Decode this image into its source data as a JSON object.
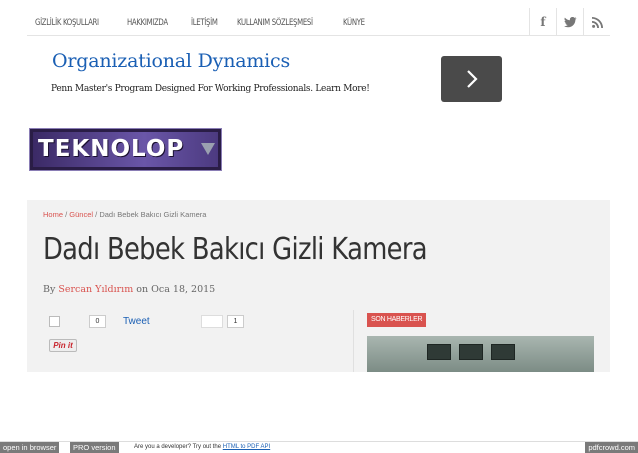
{
  "nav": {
    "links": [
      "GİZLİLİK KOŞULLARI",
      "HAKKIMIZDA",
      "İLETİŞİM",
      "KULLANIM SÖZLEŞMESİ",
      "KÜNYE"
    ],
    "social": [
      "facebook-icon",
      "twitter-icon",
      "rss-icon"
    ],
    "social_glyphs": [
      "f",
      "t",
      "≋"
    ]
  },
  "ad": {
    "title": "Organizational Dynamics",
    "subtitle": "Penn Master's Program Designed For Working Professionals. Learn More!",
    "arrow": "›"
  },
  "logo": {
    "text": "TEKNOLOP"
  },
  "breadcrumb": {
    "home": "Home",
    "sep1": " / ",
    "category": "Güncel",
    "sep2": " / ",
    "current": "Dadı Bebek Bakıcı Gizli Kamera"
  },
  "article": {
    "title": "Dadı Bebek Bakıcı Gizli Kamera",
    "by": "By ",
    "author": "Sercan Yıldırım",
    "date_prefix": " on ",
    "date": "Oca 18, 2015"
  },
  "share": {
    "fb_count": "0",
    "tweet_label": "Tweet",
    "gplus_count": "1",
    "pin_label": "Pin it"
  },
  "sidebar": {
    "badge": "SON HABERLER"
  },
  "footer": {
    "open_browser": "open in browser",
    "pro_version": "PRO version",
    "dev_text": "Are you a developer? Try out the ",
    "dev_link": "HTML to PDF API",
    "brand": "pdfcrowd.com"
  },
  "colors": {
    "accent": "#d9534f",
    "link": "#1a5fb4",
    "logo_bg": "#3b2a66"
  }
}
